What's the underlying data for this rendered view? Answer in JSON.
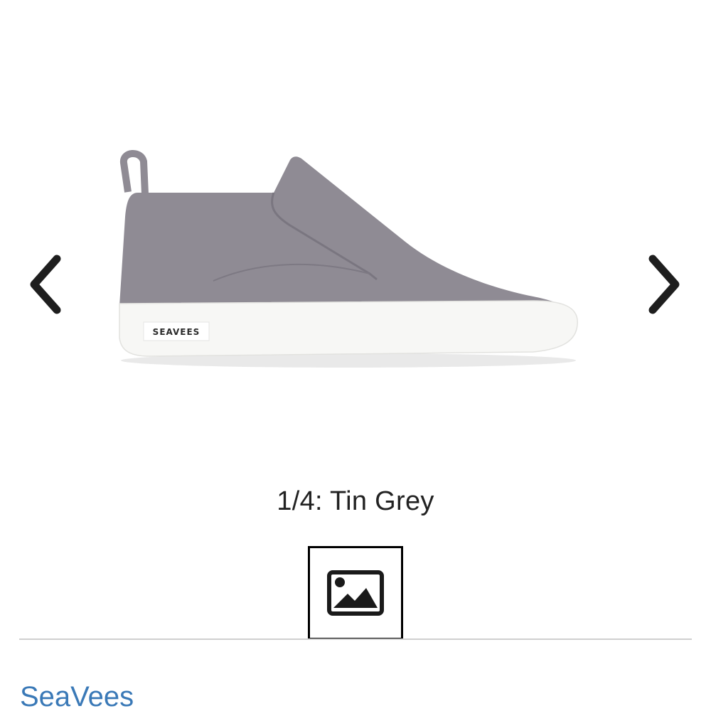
{
  "product": {
    "image_alt": "SeaVees Tin Grey slip-on chukka sneaker",
    "sole_logo_text": "SEAVEES",
    "colors": {
      "upper": "#8f8b94",
      "sole": "#f7f7f5"
    }
  },
  "carousel": {
    "prev_icon": "chevron-left-icon",
    "next_icon": "chevron-right-icon",
    "caption": "1/4: Tin Grey"
  },
  "thumbnail": {
    "icon": "image-placeholder-icon"
  },
  "brand": {
    "link_text": "SeaVees",
    "link_color": "#3a79b7"
  }
}
